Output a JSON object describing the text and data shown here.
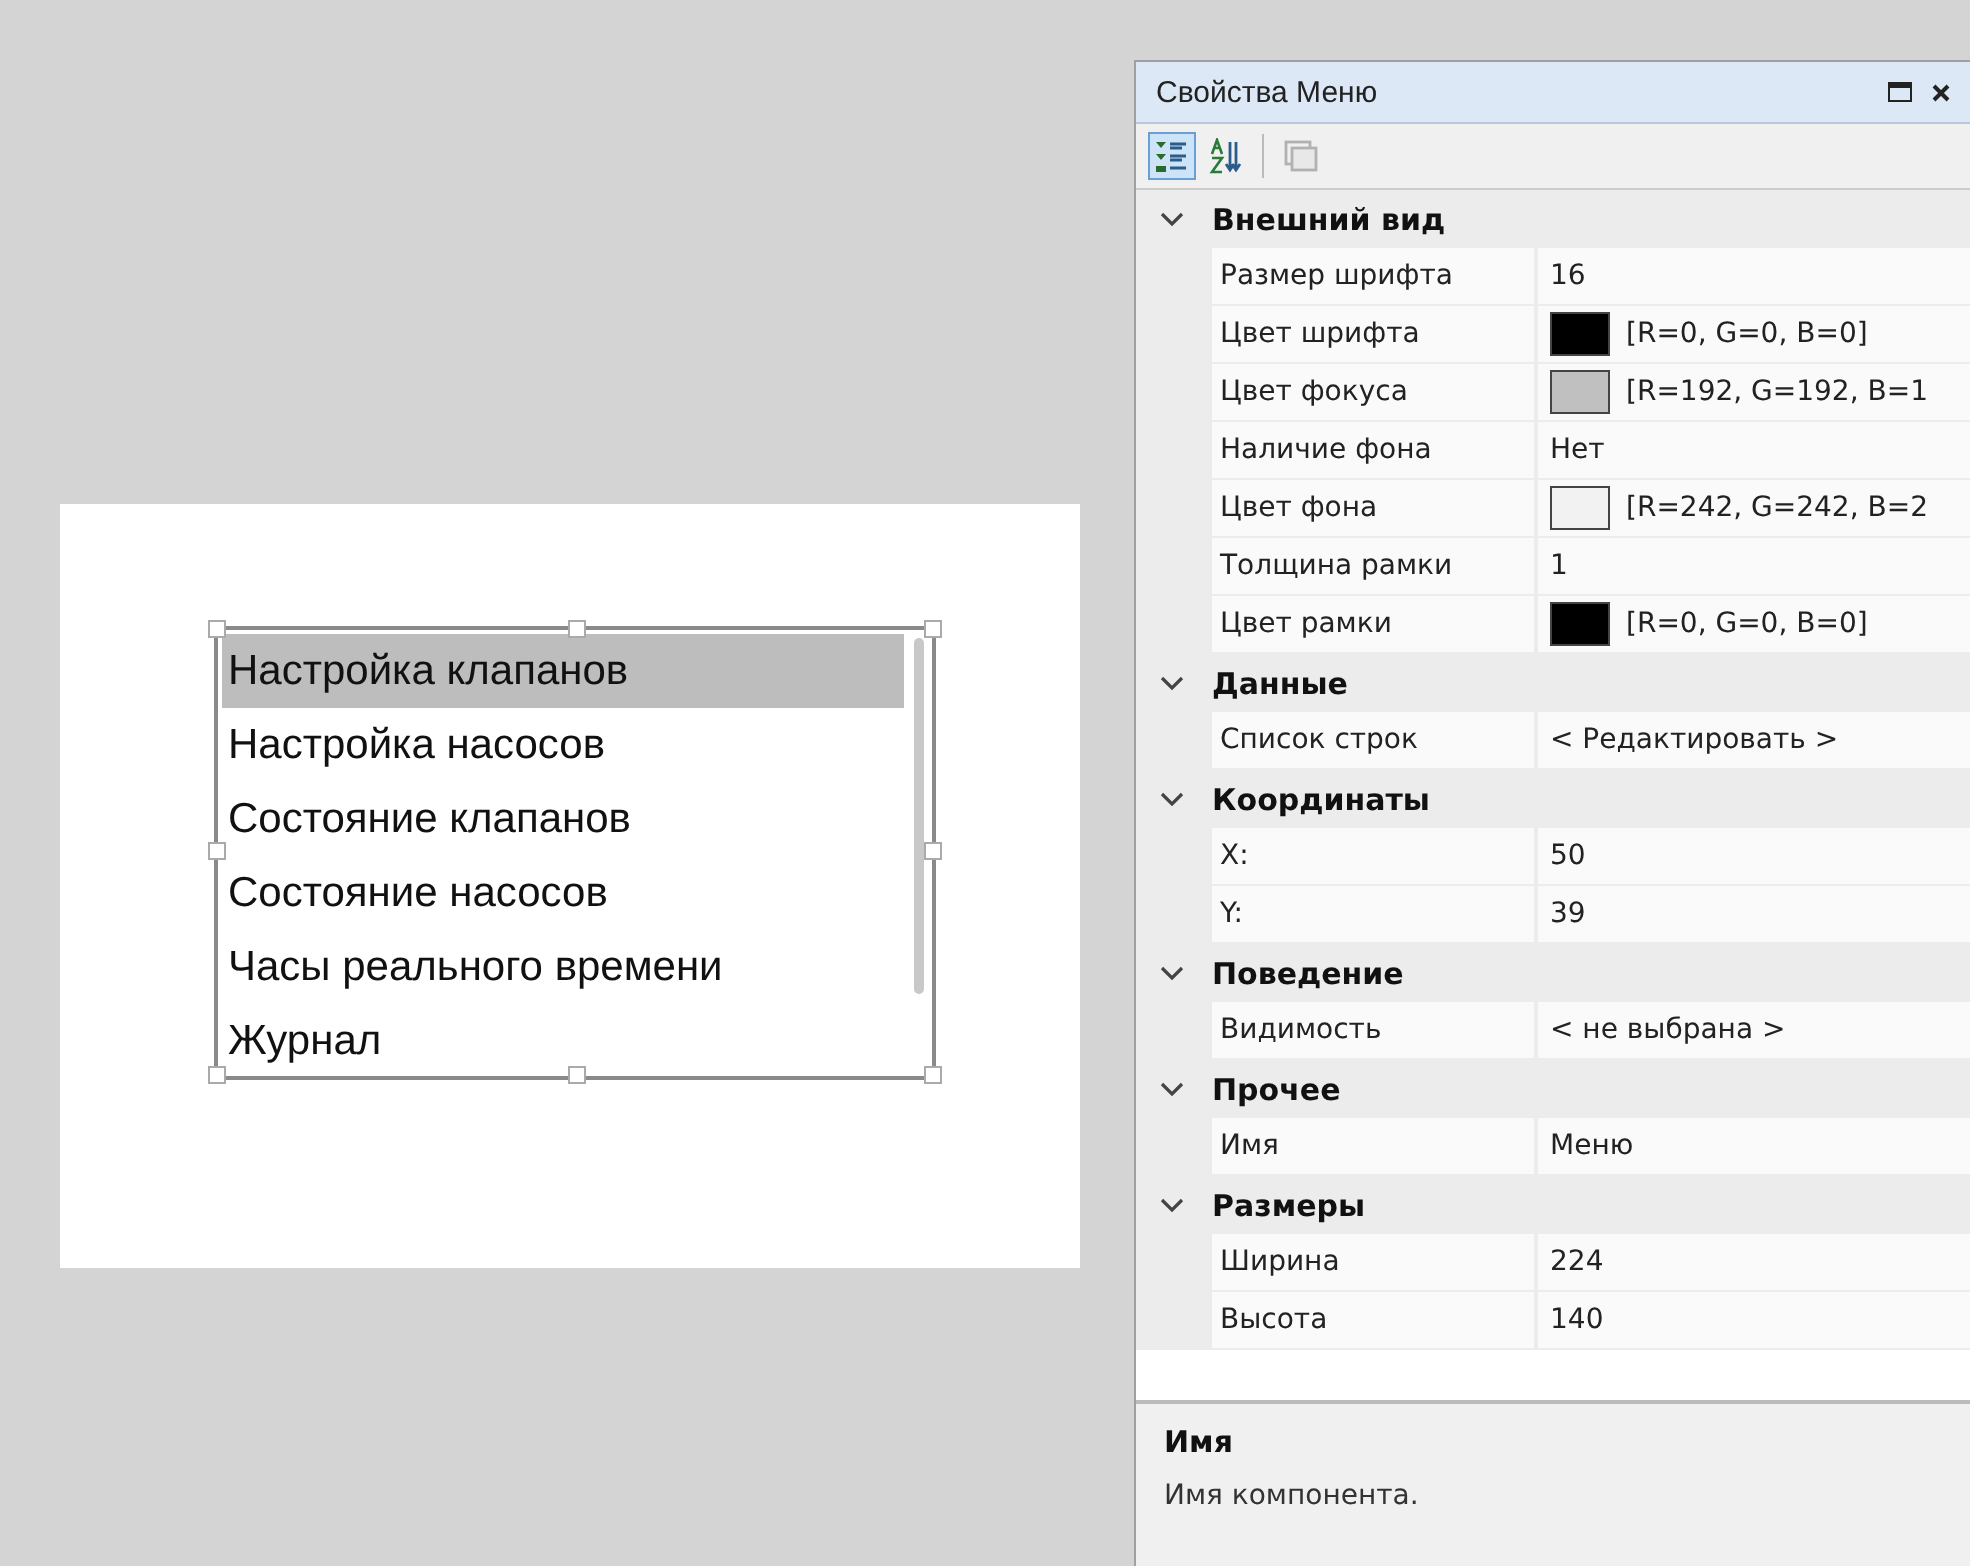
{
  "canvas": {
    "menu": {
      "items": [
        {
          "label": "Настройка клапанов",
          "selected": true
        },
        {
          "label": "Настройка насосов",
          "selected": false
        },
        {
          "label": "Состояние клапанов",
          "selected": false
        },
        {
          "label": "Состояние насосов",
          "selected": false
        },
        {
          "label": "Часы реального времени",
          "selected": false
        },
        {
          "label": "Журнал",
          "selected": false
        }
      ]
    }
  },
  "properties_panel": {
    "title": "Свойства Меню",
    "toolbar": [
      {
        "kind": "categorized",
        "selected": true,
        "disabled": false
      },
      {
        "kind": "alphabetical",
        "selected": false,
        "disabled": false
      },
      {
        "kind": "pages",
        "selected": false,
        "disabled": true
      }
    ],
    "groups": [
      {
        "name": "Внешний вид",
        "expanded": true,
        "rows": [
          {
            "kind": "text",
            "name": "Размер шрифта",
            "value": "16"
          },
          {
            "kind": "color",
            "name": "Цвет шрифта",
            "value": "[R=0, G=0, B=0]",
            "color": "#000000"
          },
          {
            "kind": "color",
            "name": "Цвет фокуса",
            "value": "[R=192, G=192, B=1",
            "color": "#c0c0c0"
          },
          {
            "kind": "text",
            "name": "Наличие фона",
            "value": "Нет"
          },
          {
            "kind": "color",
            "name": "Цвет фона",
            "value": "[R=242, G=242, B=2",
            "color": "#f2f2f2"
          },
          {
            "kind": "text",
            "name": "Толщина рамки",
            "value": "1"
          },
          {
            "kind": "color",
            "name": "Цвет рамки",
            "value": "[R=0, G=0, B=0]",
            "color": "#000000"
          }
        ]
      },
      {
        "name": "Данные",
        "expanded": true,
        "rows": [
          {
            "kind": "text",
            "name": "Список строк",
            "value": "< Редактировать >"
          }
        ]
      },
      {
        "name": "Координаты",
        "expanded": true,
        "rows": [
          {
            "kind": "text",
            "name": "X:",
            "value": "50"
          },
          {
            "kind": "text",
            "name": "Y:",
            "value": "39"
          }
        ]
      },
      {
        "name": "Поведение",
        "expanded": true,
        "rows": [
          {
            "kind": "text",
            "name": "Видимость",
            "value": "< не выбрана >"
          }
        ]
      },
      {
        "name": "Прочее",
        "expanded": true,
        "rows": [
          {
            "kind": "text",
            "name": "Имя",
            "value": "Меню"
          }
        ]
      },
      {
        "name": "Размеры",
        "expanded": true,
        "rows": [
          {
            "kind": "text",
            "name": "Ширина",
            "value": "224"
          },
          {
            "kind": "text",
            "name": "Высота",
            "value": "140"
          }
        ]
      }
    ],
    "description": {
      "title": "Имя",
      "text": "Имя компонента."
    }
  }
}
